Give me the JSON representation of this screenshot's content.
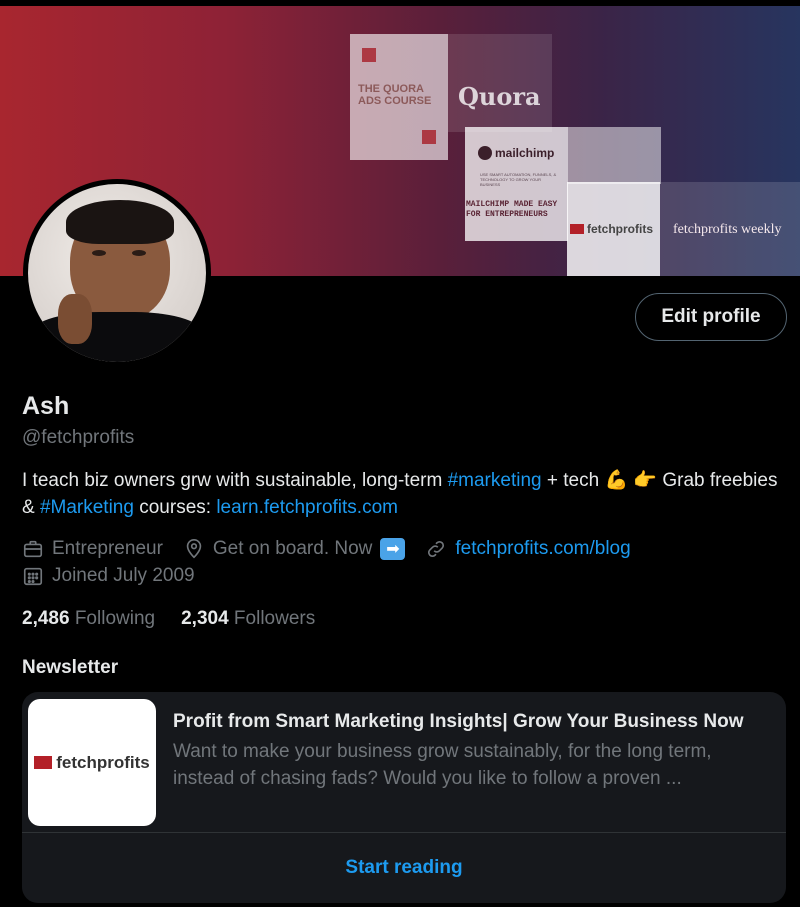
{
  "banner": {
    "quora_course_text": "THE QUORA ADS COURSE",
    "quora_word": "Quora",
    "mailchimp_logo_text": "mailchimp",
    "mailchimp_small_text": "USE SMART AUTOMATION, FUNNELS, & TECHNOLOGY TO GROW YOUR BUSINESS",
    "mailchimp_title": "MAILCHIMP MADE EASY FOR ENTREPRENEURS",
    "fetchprofits_logo_text": "fetchprofits",
    "fetchprofits_weekly_text": "fetchprofits weekly"
  },
  "profile": {
    "name": "Ash",
    "handle": "@fetchprofits",
    "edit_button_label": "Edit profile",
    "bio": {
      "part1": "I teach biz owners grw with sustainable, long-term ",
      "hashtag1": "#marketing",
      "part2": " + tech ",
      "emoji1": "💪",
      "emoji2": "👉",
      "part3": " Grab freebies & ",
      "hashtag2": "#Marketing",
      "part4": " courses: ",
      "link": "learn.fetchprofits.com"
    },
    "meta": {
      "profession": "Entrepreneur",
      "location": "Get on board. Now",
      "location_emoji": "➡",
      "website": "fetchprofits.com/blog",
      "joined": "Joined July 2009"
    },
    "following_count": "2,486",
    "following_label": "Following",
    "followers_count": "2,304",
    "followers_label": "Followers"
  },
  "newsletter": {
    "heading": "Newsletter",
    "thumb_logo_text": "fetchprofits",
    "title": "Profit from Smart Marketing Insights| Grow Your Business Now",
    "description": "Want to make your business grow sustainably, for the long term, instead of chasing fads? Would you like to follow a proven ...",
    "cta": "Start reading"
  },
  "colors": {
    "background": "#000000",
    "accent": "#1d9bf0",
    "text_primary": "#e7e9ea",
    "text_secondary": "#71767b",
    "card_bg": "#16181c"
  },
  "icons": {
    "profession": "briefcase-icon",
    "location": "location-pin-icon",
    "website": "link-icon",
    "joined": "calendar-icon"
  }
}
